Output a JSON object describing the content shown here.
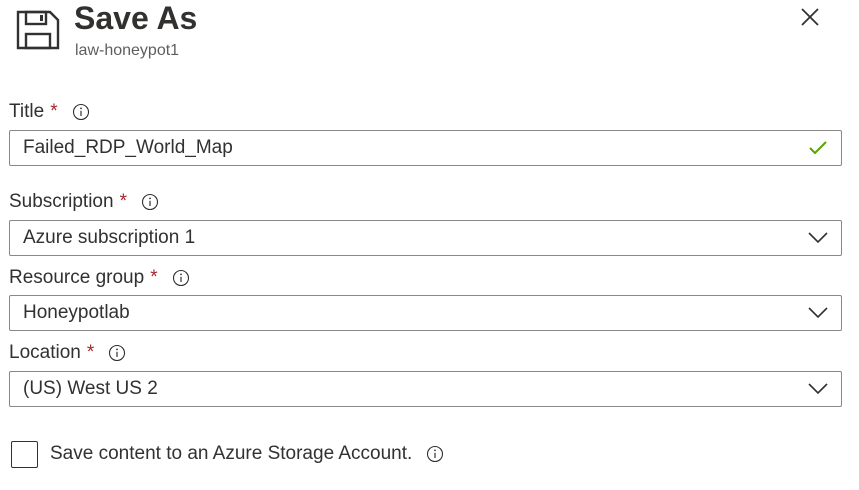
{
  "header": {
    "title": "Save As",
    "subtitle": "law-honeypot1",
    "icon": "save-icon",
    "close_icon": "close-icon"
  },
  "form": {
    "title": {
      "label": "Title",
      "required_mark": "*",
      "value": "Failed_RDP_World_Map",
      "valid": true
    },
    "subscription": {
      "label": "Subscription",
      "required_mark": "*",
      "value": "Azure subscription 1"
    },
    "resource_group": {
      "label": "Resource group",
      "required_mark": "*",
      "value": "Honeypotlab"
    },
    "location": {
      "label": "Location",
      "required_mark": "*",
      "value": "(US) West US 2"
    },
    "storage": {
      "label": "Save content to an Azure Storage Account.",
      "checked": false
    }
  },
  "colors": {
    "required": "#a4262c",
    "valid_check": "#57a300",
    "border": "#8a8886",
    "text": "#323130"
  }
}
